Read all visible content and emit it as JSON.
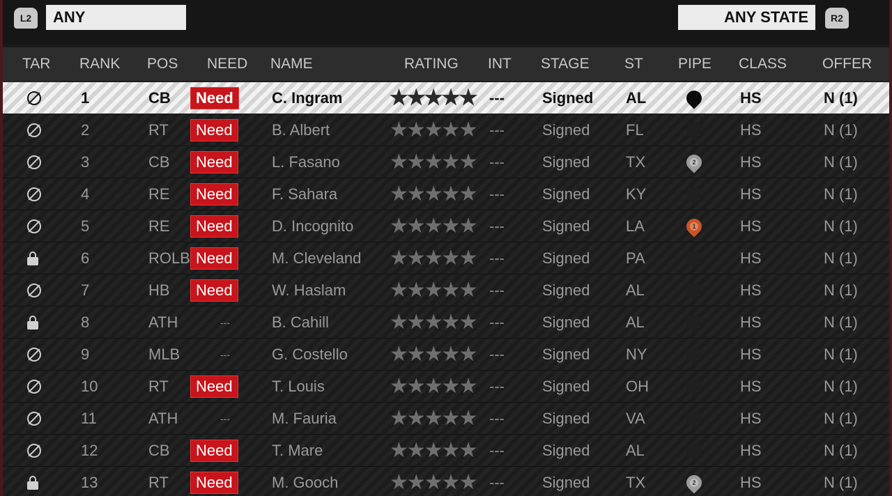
{
  "filters": {
    "left_button": "L2",
    "left_value": "ANY",
    "right_value": "ANY STATE",
    "right_button": "R2"
  },
  "columns": [
    "TAR",
    "RANK",
    "POS",
    "NEED",
    "NAME",
    "RATING",
    "INT",
    "STAGE",
    "ST",
    "PIPE",
    "CLASS",
    "OFFER"
  ],
  "rows": [
    {
      "tar": "target-icon",
      "rank": "1",
      "pos": "CB",
      "need": "Need",
      "name": "C. Ingram",
      "int": "---",
      "stage": "Signed",
      "st": "AL",
      "pipe": "black",
      "pipe_label": "",
      "class": "HS",
      "offer": "N (1)",
      "selected": true
    },
    {
      "tar": "target-icon",
      "rank": "2",
      "pos": "RT",
      "need": "Need",
      "name": "B. Albert",
      "int": "---",
      "stage": "Signed",
      "st": "FL",
      "pipe": "dark",
      "pipe_label": "",
      "class": "HS",
      "offer": "N (1)"
    },
    {
      "tar": "target-icon",
      "rank": "3",
      "pos": "CB",
      "need": "Need",
      "name": "L. Fasano",
      "int": "---",
      "stage": "Signed",
      "st": "TX",
      "pipe": "gray",
      "pipe_label": "2",
      "class": "HS",
      "offer": "N (1)"
    },
    {
      "tar": "target-icon",
      "rank": "4",
      "pos": "RE",
      "need": "Need",
      "name": "F. Sahara",
      "int": "---",
      "stage": "Signed",
      "st": "KY",
      "pipe": "dark",
      "pipe_label": "",
      "class": "HS",
      "offer": "N (1)"
    },
    {
      "tar": "target-icon",
      "rank": "5",
      "pos": "RE",
      "need": "Need",
      "name": "D. Incognito",
      "int": "---",
      "stage": "Signed",
      "st": "LA",
      "pipe": "orange",
      "pipe_label": "1",
      "class": "HS",
      "offer": "N (1)"
    },
    {
      "tar": "lock-icon",
      "rank": "6",
      "pos": "ROLB",
      "need": "Need",
      "name": "M. Cleveland",
      "int": "---",
      "stage": "Signed",
      "st": "PA",
      "pipe": "dark",
      "pipe_label": "",
      "class": "HS",
      "offer": "N (1)"
    },
    {
      "tar": "target-icon",
      "rank": "7",
      "pos": "HB",
      "need": "Need",
      "name": "W. Haslam",
      "int": "---",
      "stage": "Signed",
      "st": "AL",
      "pipe": "dark",
      "pipe_label": "",
      "class": "HS",
      "offer": "N (1)"
    },
    {
      "tar": "lock-icon",
      "rank": "8",
      "pos": "ATH",
      "need": "---",
      "name": "B. Cahill",
      "int": "---",
      "stage": "Signed",
      "st": "AL",
      "pipe": "dark",
      "pipe_label": "",
      "class": "HS",
      "offer": "N (1)"
    },
    {
      "tar": "target-icon",
      "rank": "9",
      "pos": "MLB",
      "need": "---",
      "name": "G. Costello",
      "int": "---",
      "stage": "Signed",
      "st": "NY",
      "pipe": "dark",
      "pipe_label": "",
      "class": "HS",
      "offer": "N (1)"
    },
    {
      "tar": "target-icon",
      "rank": "10",
      "pos": "RT",
      "need": "Need",
      "name": "T. Louis",
      "int": "---",
      "stage": "Signed",
      "st": "OH",
      "pipe": "dark",
      "pipe_label": "",
      "class": "HS",
      "offer": "N (1)"
    },
    {
      "tar": "target-icon",
      "rank": "11",
      "pos": "ATH",
      "need": "---",
      "name": "M. Fauria",
      "int": "---",
      "stage": "Signed",
      "st": "VA",
      "pipe": "dark",
      "pipe_label": "",
      "class": "HS",
      "offer": "N (1)"
    },
    {
      "tar": "target-icon",
      "rank": "12",
      "pos": "CB",
      "need": "Need",
      "name": "T. Mare",
      "int": "---",
      "stage": "Signed",
      "st": "AL",
      "pipe": "dark",
      "pipe_label": "",
      "class": "HS",
      "offer": "N (1)"
    },
    {
      "tar": "lock-icon",
      "rank": "13",
      "pos": "RT",
      "need": "Need",
      "name": "M. Gooch",
      "int": "---",
      "stage": "Signed",
      "st": "TX",
      "pipe": "gray",
      "pipe_label": "2",
      "class": "HS",
      "offer": "N (1)"
    }
  ],
  "rating_stars": 5,
  "colors": {
    "need_badge": "#c8141b",
    "selected_row": "#e6e6e6"
  }
}
